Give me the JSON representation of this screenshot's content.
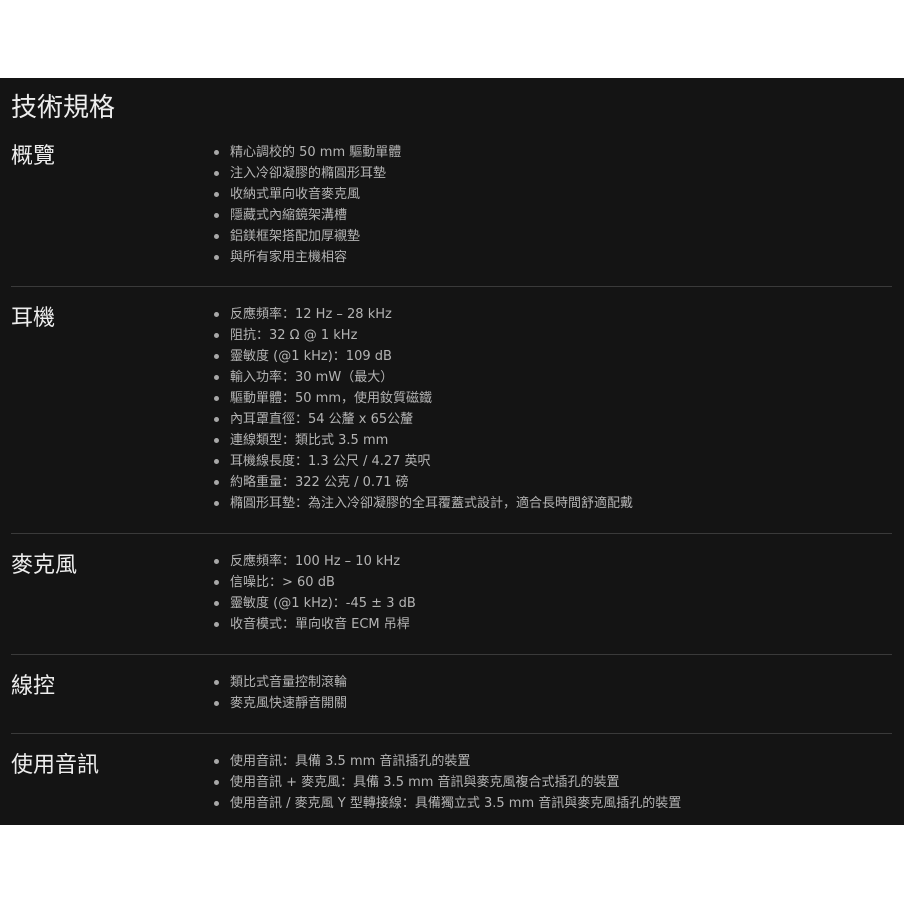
{
  "page": {
    "title": "技術規格"
  },
  "sections": [
    {
      "title": "概覽",
      "items": [
        "精心調校的 50 mm 驅動單體",
        "注入冷卻凝膠的橢圓形耳墊",
        "收納式單向收音麥克風",
        "隱藏式內縮鏡架溝槽",
        "鋁鎂框架搭配加厚襯墊",
        "與所有家用主機相容"
      ]
    },
    {
      "title": "耳機",
      "items": [
        "反應頻率：12 Hz – 28 kHz",
        "阻抗：32 Ω @ 1 kHz",
        "靈敏度 (@1 kHz)：109 dB",
        "輸入功率：30 mW（最大）",
        "驅動單體：50 mm，使用釹質磁鐵",
        "內耳罩直徑：54 公釐 x 65公釐",
        "連線類型：類比式 3.5 mm",
        "耳機線長度：1.3 公尺 / 4.27 英呎",
        "約略重量：322 公克 / 0.71 磅",
        "橢圓形耳墊：為注入冷卻凝膠的全耳覆蓋式設計，適合長時間舒適配戴"
      ]
    },
    {
      "title": "麥克風",
      "items": [
        "反應頻率：100 Hz – 10 kHz",
        "信噪比：> 60 dB",
        "靈敏度 (@1 kHz)：-45 ± 3 dB",
        "收音模式：單向收音 ECM 吊桿"
      ]
    },
    {
      "title": "線控",
      "items": [
        "類比式音量控制滾輪",
        "麥克風快速靜音開關"
      ]
    },
    {
      "title": "使用音訊",
      "items": [
        "使用音訊：具備 3.5 mm 音訊插孔的裝置",
        "使用音訊 + 麥克風：具備 3.5 mm 音訊與麥克風複合式插孔的裝置",
        "使用音訊 / 麥克風 Y 型轉接線：具備獨立式 3.5 mm 音訊與麥克風插孔的裝置"
      ]
    }
  ]
}
